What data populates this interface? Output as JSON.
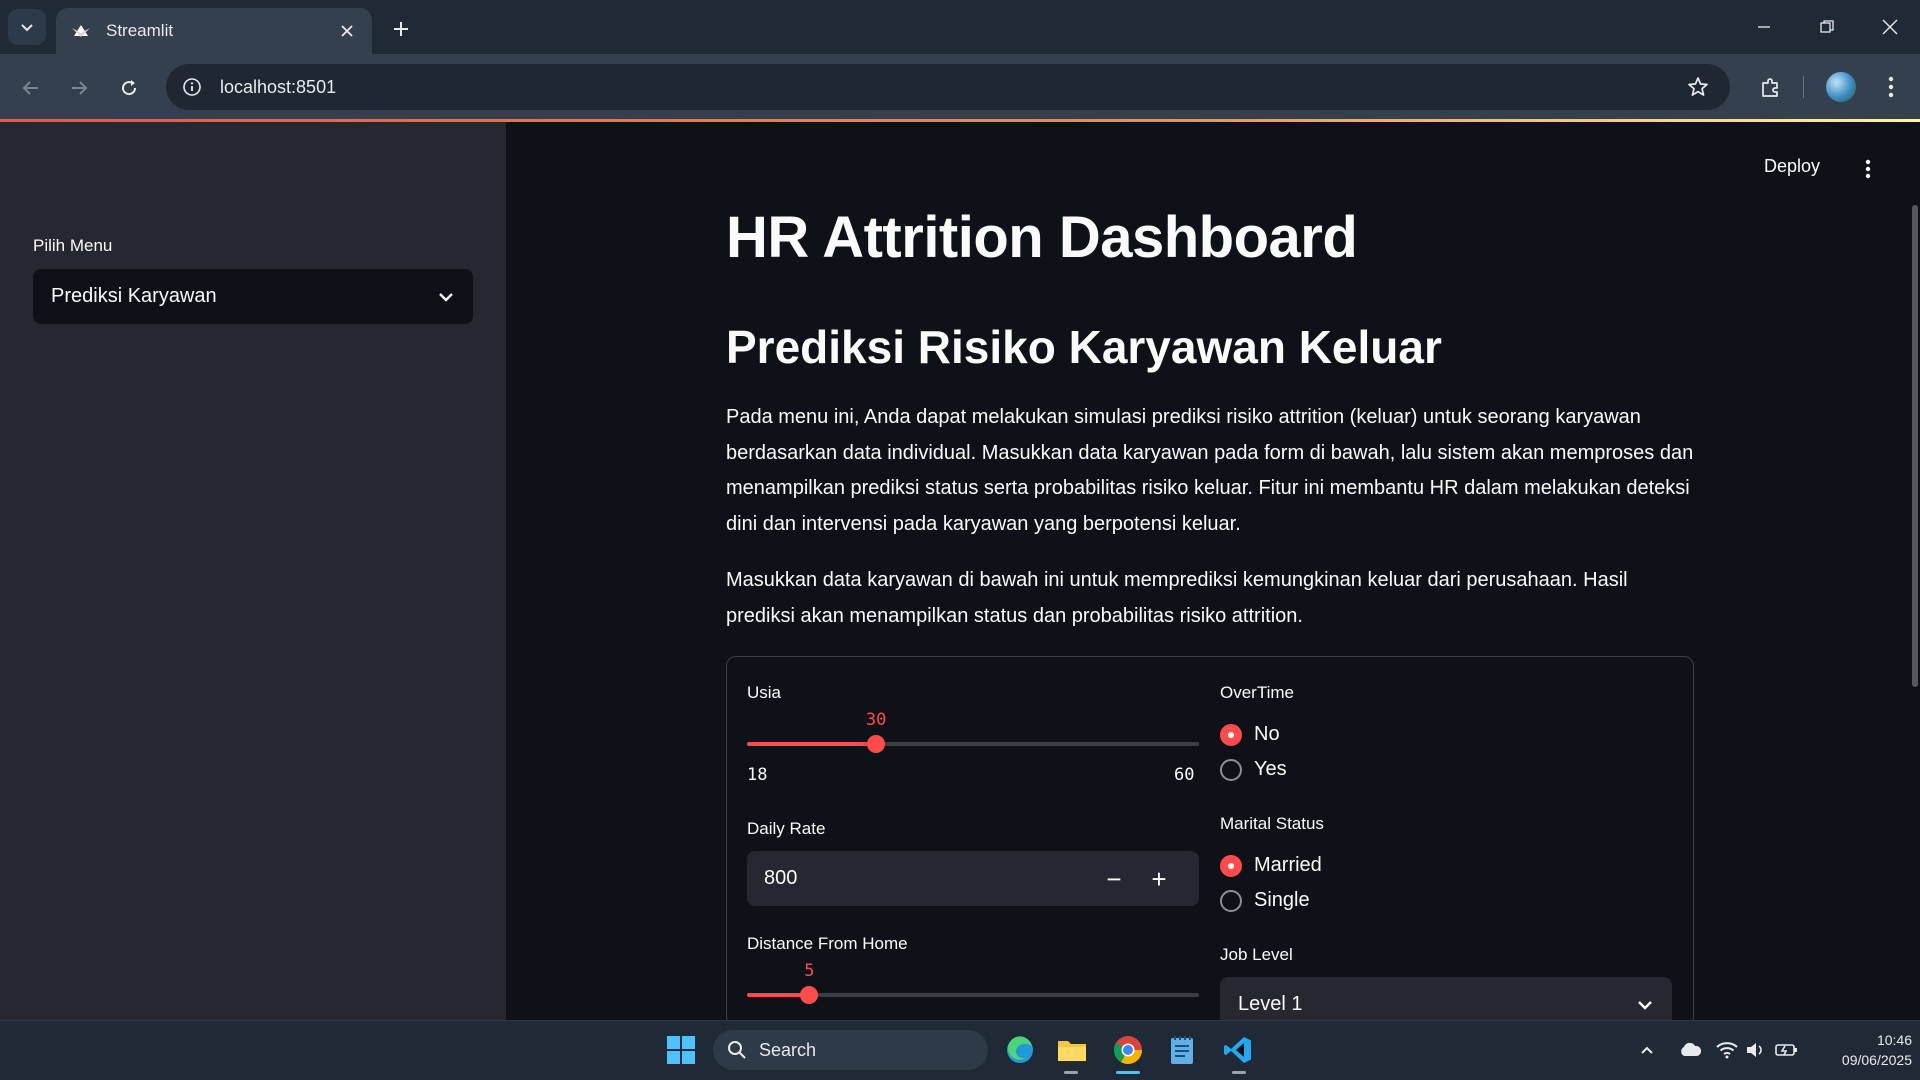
{
  "browser": {
    "tab_title": "Streamlit",
    "url": "localhost:8501"
  },
  "app": {
    "deploy_label": "Deploy",
    "sidebar": {
      "menu_label": "Pilih Menu",
      "menu_value": "Prediksi Karyawan"
    },
    "title": "HR Attrition Dashboard",
    "subtitle": "Prediksi Risiko Karyawan Keluar",
    "paragraph_1": "Pada menu ini, Anda dapat melakukan simulasi prediksi risiko attrition (keluar) untuk seorang karyawan berdasarkan data individual. Masukkan data karyawan pada form di bawah, lalu sistem akan memproses dan menampilkan prediksi status serta probabilitas risiko keluar. Fitur ini membantu HR dalam melakukan deteksi dini dan intervensi pada karyawan yang berpotensi keluar.",
    "paragraph_2": "Masukkan data karyawan di bawah ini untuk memprediksi kemungkinan keluar dari perusahaan. Hasil prediksi akan menampilkan status dan probabilitas risiko attrition.",
    "form": {
      "usia": {
        "label": "Usia",
        "value": "30",
        "min": "18",
        "max": "60",
        "value_num": 30,
        "min_num": 18,
        "max_num": 60
      },
      "daily_rate": {
        "label": "Daily Rate",
        "value": "800",
        "minus": "−",
        "plus": "+"
      },
      "distance": {
        "label": "Distance From Home",
        "value": "5",
        "value_num": 5,
        "min_num": 1,
        "max_num": 30
      },
      "overtime": {
        "label": "OverTime",
        "options": [
          "No",
          "Yes"
        ],
        "selected": "No"
      },
      "marital": {
        "label": "Marital Status",
        "options": [
          "Married",
          "Single"
        ],
        "selected": "Married"
      },
      "job_level": {
        "label": "Job Level",
        "value": "Level 1"
      }
    },
    "accent_color": "#ff4b4b"
  },
  "taskbar": {
    "search_label": "Search",
    "time": "10:46",
    "date": "09/06/2025"
  }
}
